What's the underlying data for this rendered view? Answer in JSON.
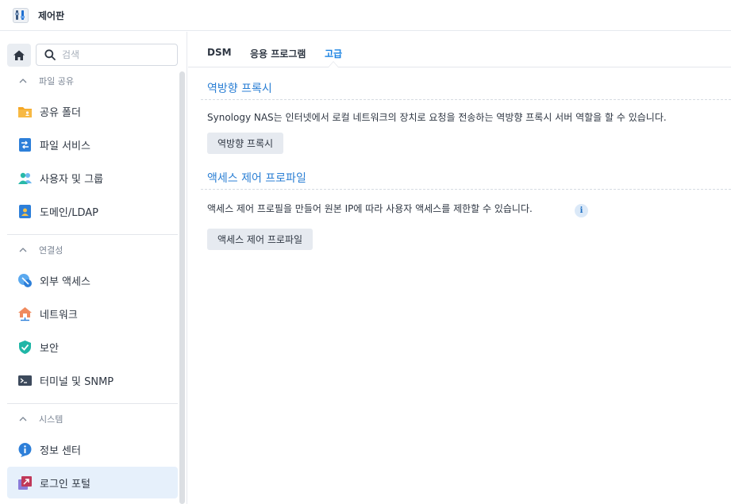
{
  "window": {
    "title": "제어판",
    "app_icon": "control-panel-icon"
  },
  "search": {
    "placeholder": "검색",
    "value": ""
  },
  "sidebar": {
    "sections": [
      {
        "label": "파일 공유",
        "items": [
          {
            "label": "공유 폴더",
            "icon": "shared-folder-icon"
          },
          {
            "label": "파일 서비스",
            "icon": "file-services-icon"
          },
          {
            "label": "사용자 및 그룹",
            "icon": "users-groups-icon"
          },
          {
            "label": "도메인/LDAP",
            "icon": "domain-ldap-icon"
          }
        ]
      },
      {
        "label": "연결성",
        "items": [
          {
            "label": "외부 액세스",
            "icon": "external-access-icon"
          },
          {
            "label": "네트워크",
            "icon": "network-icon"
          },
          {
            "label": "보안",
            "icon": "security-shield-icon"
          },
          {
            "label": "터미널 및 SNMP",
            "icon": "terminal-icon"
          }
        ]
      },
      {
        "label": "시스템",
        "items": [
          {
            "label": "정보 센터",
            "icon": "info-center-icon"
          },
          {
            "label": "로그인 포털",
            "icon": "login-portal-icon",
            "active": true
          }
        ]
      }
    ]
  },
  "tabs": [
    {
      "label": "DSM"
    },
    {
      "label": "응용 프로그램"
    },
    {
      "label": "고급",
      "active": true
    }
  ],
  "content": {
    "reverse_proxy": {
      "title": "역방향 프록시",
      "description": "Synology NAS는 인터넷에서 로컬 네트워크의 장치로 요청을 전송하는 역방향 프록시 서버 역할을 할 수 있습니다.",
      "button": "역방향 프록시"
    },
    "access_control": {
      "title": "액세스 제어 프로파일",
      "description": "액세스 제어 프로필을 만들어 원본 IP에 따라 사용자 액세스를 제한할 수 있습니다.",
      "button": "액세스 제어 프로파일",
      "info_glyph": "i"
    }
  },
  "colors": {
    "accent": "#1a82e2",
    "section_title": "#2b7fd4",
    "active_item_bg": "#e6f0fb"
  }
}
